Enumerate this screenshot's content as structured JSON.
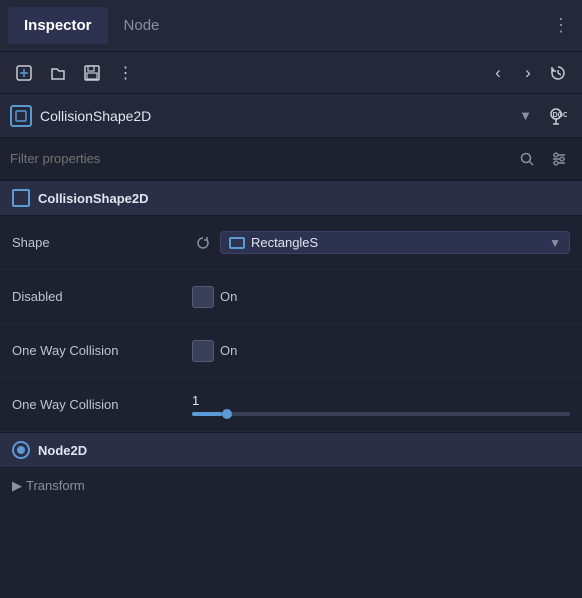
{
  "tabs": {
    "inspector": "Inspector",
    "node": "Node"
  },
  "toolbar": {
    "icons": [
      "new-script",
      "open-file",
      "save",
      "more-options"
    ],
    "nav": [
      "arrow-left",
      "arrow-right",
      "history"
    ]
  },
  "node_selector": {
    "label": "CollisionShape2D",
    "icon": "collision-shape-icon",
    "doc_label": "DOC"
  },
  "filter": {
    "placeholder": "Filter properties"
  },
  "section": {
    "collision_shape_label": "CollisionShape2D",
    "node2d_label": "Node2D"
  },
  "properties": {
    "shape": {
      "label": "Shape",
      "value": "RectangleS"
    },
    "disabled": {
      "label": "Disabled",
      "value": "On"
    },
    "one_way_collision": {
      "label": "One Way Collision",
      "value": "On"
    },
    "one_way_collision_margin": {
      "label": "One Way Collision",
      "value": "1",
      "slider_percent": 8
    }
  },
  "bottom": {
    "transform_label": "Transform"
  }
}
